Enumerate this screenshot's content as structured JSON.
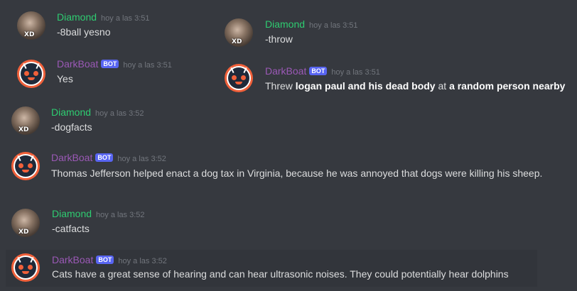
{
  "messages": [
    {
      "author": "Diamond",
      "time": "hoy a las 3:51",
      "text": "-8ball yesno",
      "avatar_label": "XD"
    },
    {
      "author": "DarkBoat",
      "badge": "BOT",
      "time": "hoy a las 3:51",
      "text": "Yes"
    },
    {
      "author": "Diamond",
      "time": "hoy a las 3:51",
      "text": "-throw",
      "avatar_label": "XD"
    },
    {
      "author": "DarkBoat",
      "badge": "BOT",
      "time": "hoy a las 3:51",
      "text_parts": [
        "Threw ",
        "logan paul and his dead body",
        " at ",
        "a random person nearby"
      ]
    },
    {
      "author": "Diamond",
      "time": "hoy a las 3:52",
      "text": "-dogfacts",
      "avatar_label": "XD"
    },
    {
      "author": "DarkBoat",
      "badge": "BOT",
      "time": "hoy a las 3:52",
      "text": "Thomas Jefferson helped enact a dog tax in Virginia, because he was annoyed that dogs were killing his sheep."
    },
    {
      "author": "Diamond",
      "time": "hoy a las 3:52",
      "text": "-catfacts",
      "avatar_label": "XD"
    },
    {
      "author": "DarkBoat",
      "badge": "BOT",
      "time": "hoy a las 3:52",
      "text": "Cats have a great sense of hearing and can hear ultrasonic noises. They could potentially hear dolphins"
    }
  ],
  "colors": {
    "background": "#36393f",
    "diamond_name": "#2ecc71",
    "bot_name": "#9b59b6",
    "bot_badge": "#5865f2"
  }
}
